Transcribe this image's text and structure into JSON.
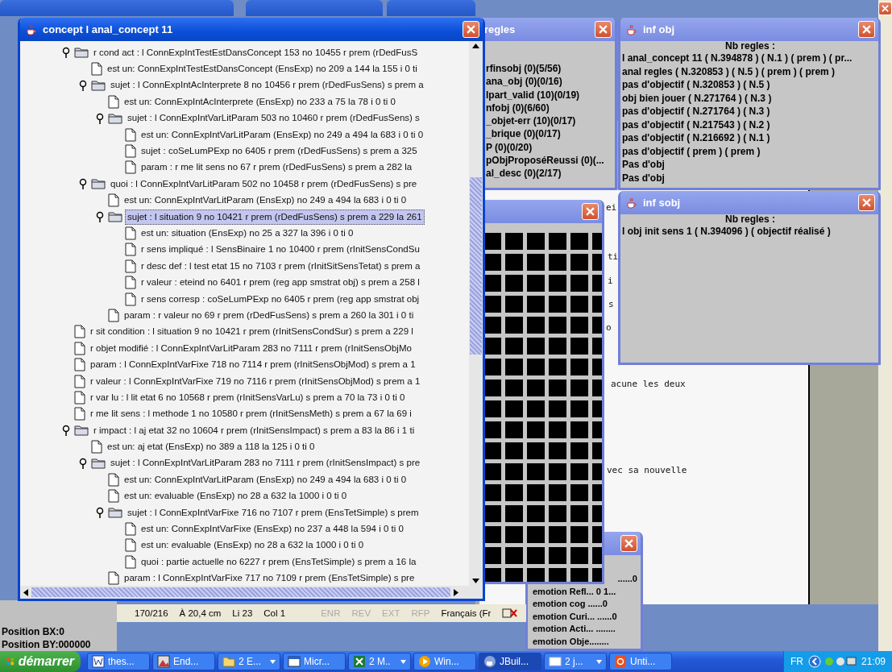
{
  "tree_window": {
    "title": "concept l anal_concept 11",
    "rows": [
      {
        "label": "r cond act : l ConnExpIntTestEstDansConcept 153 no 10455 r prem (rDedFusS",
        "kind": "folder",
        "expanded": true,
        "selected": false,
        "children": [
          {
            "label": "est un: ConnExpIntTestEstDansConcept (EnsExp) no 209 a 144 la 155 i 0 ti",
            "kind": "leaf",
            "selected": false
          },
          {
            "label": "sujet : l ConnExpIntAcInterprete 8 no 10456 r prem (rDedFusSens) s prem a",
            "kind": "folder",
            "expanded": true,
            "selected": false,
            "children": [
              {
                "label": "est un: ConnExpIntAcInterprete (EnsExp) no 233 a 75 la 78 i 0 ti 0",
                "kind": "leaf",
                "selected": false
              },
              {
                "label": "sujet : l ConnExpIntVarLitParam 503 no 10460 r prem (rDedFusSens) s",
                "kind": "folder",
                "expanded": true,
                "selected": false,
                "children": [
                  {
                    "label": "est un: ConnExpIntVarLitParam (EnsExp) no 249 a 494 la 683 i 0 ti 0",
                    "kind": "leaf",
                    "selected": false
                  },
                  {
                    "label": "sujet : coSeLumPExp no 6405 r prem (rDedFusSens) s prem a 325",
                    "kind": "leaf",
                    "selected": false
                  },
                  {
                    "label": "param : r me lit sens no 67 r prem (rDedFusSens) s prem a 282 la",
                    "kind": "leaf",
                    "selected": false
                  }
                ]
              }
            ]
          },
          {
            "label": "quoi : l ConnExpIntVarLitParam 502 no 10458 r prem (rDedFusSens) s pre",
            "kind": "folder",
            "expanded": true,
            "selected": false,
            "children": [
              {
                "label": "est un: ConnExpIntVarLitParam (EnsExp) no 249 a 494 la 683 i 0 ti 0",
                "kind": "leaf",
                "selected": false
              },
              {
                "label": "sujet : l situation 9 no 10421 r prem (rDedFusSens) s prem a 229 la 261",
                "kind": "folder",
                "expanded": true,
                "selected": true,
                "children": [
                  {
                    "label": "est un: situation (EnsExp) no 25 a 327 la 396 i 0 ti 0",
                    "kind": "leaf",
                    "selected": false
                  },
                  {
                    "label": "r sens impliqué : l SensBinaire 1 no 10400 r prem (rInitSensCondSu",
                    "kind": "leaf",
                    "selected": false
                  },
                  {
                    "label": "r desc def : l test etat 15 no 7103 r prem (rInitSitSensTetat) s prem a",
                    "kind": "leaf",
                    "selected": false
                  },
                  {
                    "label": "r valeur : eteind no 6401 r prem (reg app smstrat obj) s prem a 258 l",
                    "kind": "leaf",
                    "selected": false
                  },
                  {
                    "label": "r sens corresp : coSeLumPExp no 6405 r prem (reg app smstrat obj",
                    "kind": "leaf",
                    "selected": false
                  }
                ]
              },
              {
                "label": "param : r valeur no 69 r prem (rDedFusSens) s prem a 260 la 301 i 0 ti",
                "kind": "leaf",
                "selected": false
              }
            ]
          }
        ]
      },
      {
        "label": "r sit condition : l situation 9 no 10421 r prem (rInitSensCondSur) s prem a 229 l",
        "kind": "leaf",
        "selected": false
      },
      {
        "label": "r objet modifié : l ConnExpIntVarLitParam 283 no 7111 r prem (rInitSensObjMo",
        "kind": "leaf",
        "selected": false
      },
      {
        "label": "param : l ConnExpIntVarFixe 718 no 7114 r prem (rInitSensObjMod) s prem a 1",
        "kind": "leaf",
        "selected": false
      },
      {
        "label": "r valeur : l ConnExpIntVarFixe 719 no 7116 r prem (rInitSensObjMod) s prem a 1",
        "kind": "leaf",
        "selected": false
      },
      {
        "label": "r var lu : l lit etat 6 no 10568 r prem (rInitSensVarLu) s prem a 70 la 73 i 0 ti 0",
        "kind": "leaf",
        "selected": false
      },
      {
        "label": "r me lit sens : l methode 1 no 10580 r prem (rInitSensMeth) s prem a 67 la 69 i",
        "kind": "leaf",
        "selected": false
      },
      {
        "label": "r impact : l aj etat 32 no 10604 r prem (rInitSensImpact) s prem a 83 la 86 i 1 ti",
        "kind": "folder",
        "expanded": true,
        "selected": false,
        "children": [
          {
            "label": "est un: aj etat (EnsExp) no 389 a 118 la 125 i 0 ti 0",
            "kind": "leaf",
            "selected": false
          },
          {
            "label": "sujet : l ConnExpIntVarLitParam 283 no 7111 r prem (rInitSensImpact) s pre",
            "kind": "folder",
            "expanded": true,
            "selected": false,
            "children": [
              {
                "label": "est un: ConnExpIntVarLitParam (EnsExp) no 249 a 494 la 683 i 0 ti 0",
                "kind": "leaf",
                "selected": false
              },
              {
                "label": "est un: evaluable (EnsExp) no 28 a 632 la 1000 i 0 ti 0",
                "kind": "leaf",
                "selected": false
              },
              {
                "label": "sujet : l ConnExpIntVarFixe 716 no 7107 r prem (EnsTetSimple) s prem",
                "kind": "folder",
                "expanded": true,
                "selected": false,
                "children": [
                  {
                    "label": "est un: ConnExpIntVarFixe (EnsExp) no 237 a 448 la 594 i 0 ti 0",
                    "kind": "leaf",
                    "selected": false
                  },
                  {
                    "label": "est un: evaluable (EnsExp) no 28 a 632 la 1000 i 0 ti 0",
                    "kind": "leaf",
                    "selected": false
                  },
                  {
                    "label": "quoi : partie actuelle no 6227 r prem (EnsTetSimple) s prem a 16 la",
                    "kind": "leaf",
                    "selected": false
                  }
                ]
              },
              {
                "label": "param : l ConnExpIntVarFixe 717 no 7109 r prem (EnsTetSimple) s pre",
                "kind": "leaf",
                "selected": false
              }
            ]
          }
        ]
      }
    ]
  },
  "rules_window": {
    "title": "regles",
    "items": [
      "rfinsobj (0)(5/56)",
      "ana_obj (0)(0/16)",
      "lpart_valid (10)(0/19)",
      "nfobj (0)(6/60)",
      "_objet-err (10)(0/17)",
      "_brique (0)(0/17)",
      "P (0)(0/20)",
      "pObjProposéReussi (0)(...",
      "al_desc (0)(2/17)"
    ]
  },
  "object_info_window": {
    "title": "inf obj",
    "heading": "Nb regles :",
    "items": [
      "l anal_concept 11 ( N.394878 ) ( N.1 ) ( prem ) ( pr...",
      "anal regles ( N.320853 ) ( N.5 ) ( prem ) ( prem )",
      "pas d'objectif ( N.320853 ) ( N.5 )",
      "obj bien jouer ( N.271764 ) ( N.3 )",
      "pas d'objectif ( N.271764 ) ( N.3 )",
      "pas d'objectif ( N.217543 ) ( N.2 )",
      "pas d'objectif ( N.216692 ) ( N.1 )",
      "pas d'objectif ( prem ) ( prem )",
      "Pas d'obj",
      "Pas d'obj"
    ]
  },
  "subobject_info_window": {
    "title": "inf sobj",
    "heading": "Nb regles :",
    "items": [
      "l obj init sens 1 ( N.394096 ) ( objectif réalisé )"
    ]
  },
  "document": {
    "fragments": [
      "ei",
      "ti",
      "i",
      "s",
      "o",
      "acune les deux",
      "vec sa nouvelle"
    ]
  },
  "emotion_window": {
    "items": [
      "......0",
      "emotion Refl... 0 1...",
      "emotion cog ......0",
      "emotion Curi... ......0",
      "emotion Acti... ........",
      "emotion Obje........"
    ]
  },
  "position_panel": [
    "Position BX:0",
    "Position BY:000000"
  ],
  "word_status_bar": {
    "page": "170/216",
    "position": "À 20,4 cm",
    "line": "Li 23",
    "column": "Col 1",
    "modes": [
      {
        "label": "ENR",
        "active": false
      },
      {
        "label": "REV",
        "active": false
      },
      {
        "label": "EXT",
        "active": false
      },
      {
        "label": "RFP",
        "active": false
      }
    ],
    "language": "Français (Fr"
  },
  "taskbar": {
    "start": "démarrer",
    "tasks": [
      {
        "label": "thes...",
        "kind": "word",
        "grouped": false,
        "selected": false
      },
      {
        "label": "End...",
        "kind": "image",
        "grouped": false,
        "selected": false
      },
      {
        "label": "2 E...",
        "kind": "folder",
        "grouped": true,
        "selected": false
      },
      {
        "label": "Micr...",
        "kind": "window",
        "grouped": false,
        "selected": false
      },
      {
        "label": "2 M..",
        "kind": "sheet",
        "grouped": true,
        "selected": false
      },
      {
        "label": "Win...",
        "kind": "media",
        "grouped": false,
        "selected": false
      },
      {
        "label": "JBuil...",
        "kind": "java",
        "grouped": false,
        "selected": true
      },
      {
        "label": "2 j...",
        "kind": "blank",
        "grouped": true,
        "selected": false
      },
      {
        "label": "Unti...",
        "kind": "app",
        "grouped": false,
        "selected": false
      }
    ],
    "language": "FR",
    "clock": "21:09"
  }
}
